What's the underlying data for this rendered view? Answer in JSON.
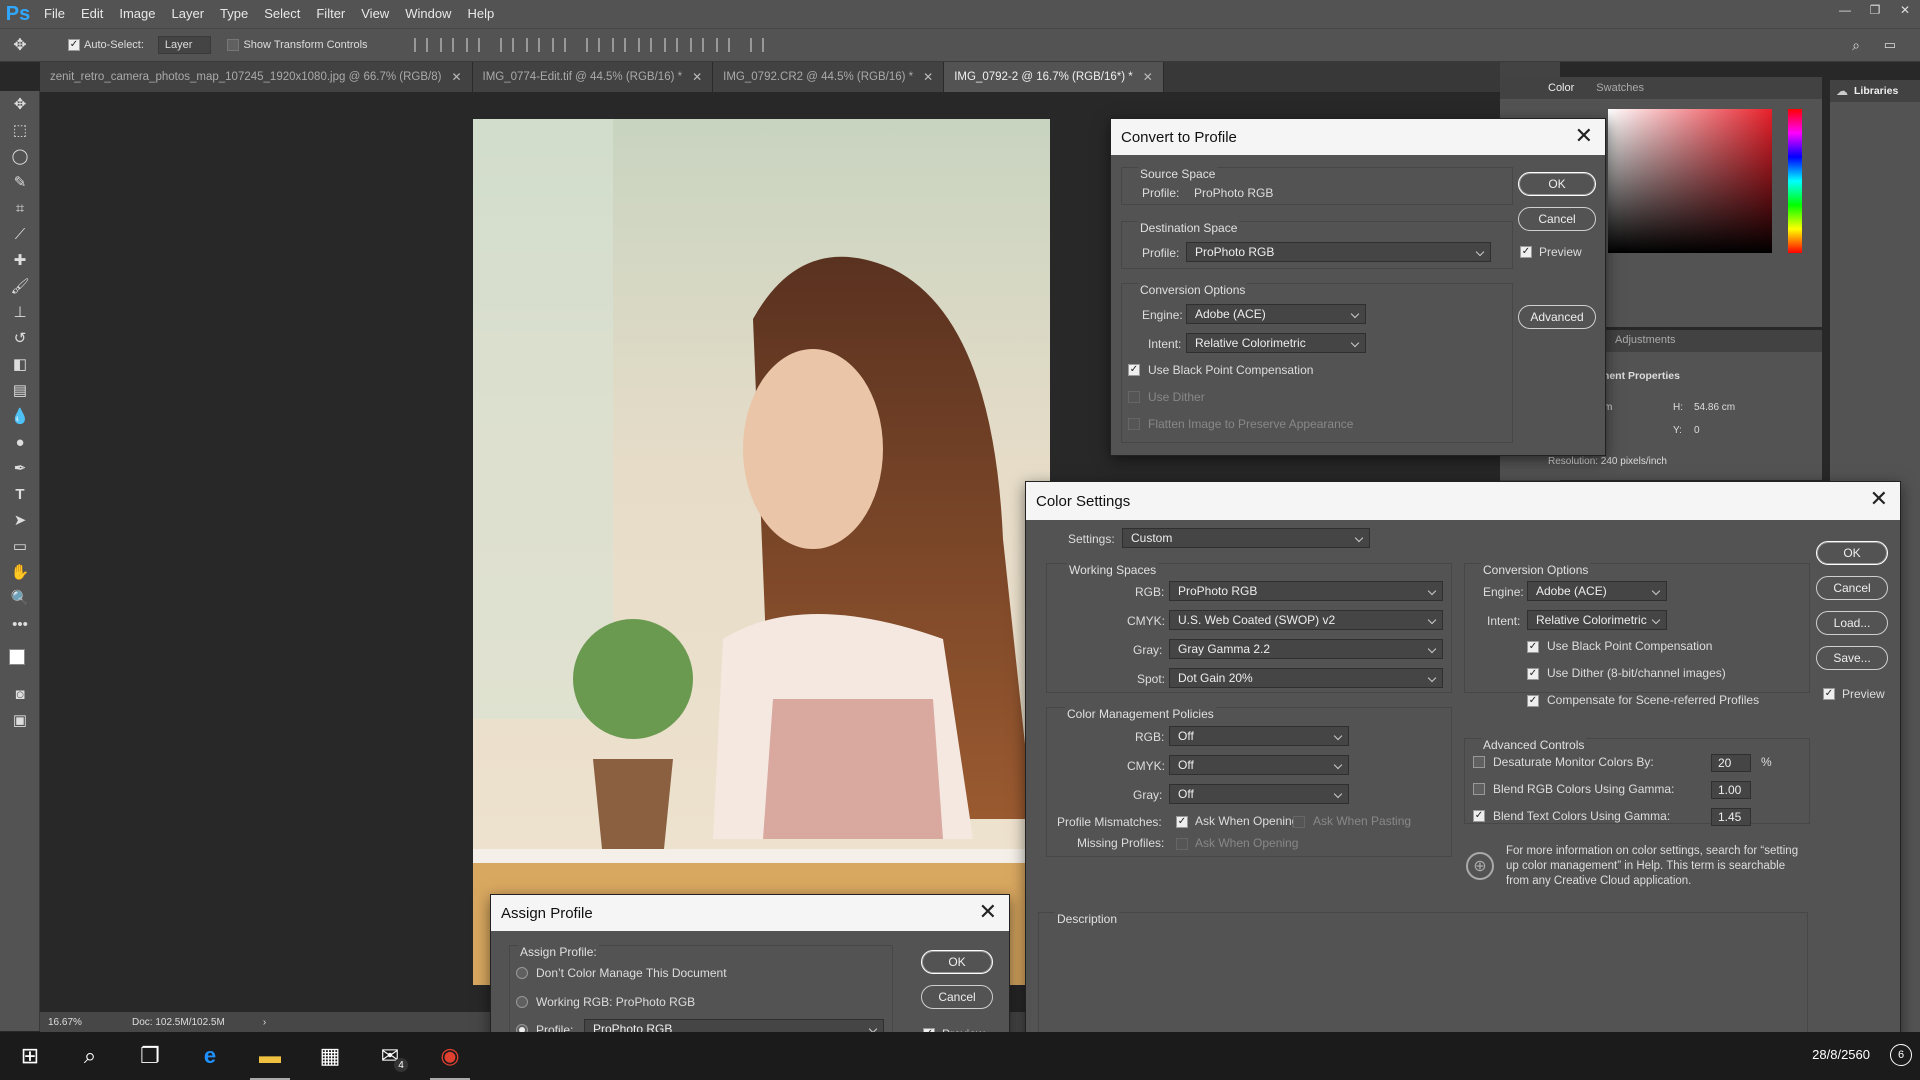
{
  "app": {
    "logo": "Ps",
    "menus": [
      "File",
      "Edit",
      "Image",
      "Layer",
      "Type",
      "Select",
      "Filter",
      "View",
      "Window",
      "Help"
    ]
  },
  "options_bar": {
    "auto_select_label": "Auto-Select:",
    "auto_select_value": "Layer",
    "show_transform_label": "Show Transform Controls"
  },
  "tabs": [
    {
      "label": "zenit_retro_camera_photos_map_107245_1920x1080.jpg @ 66.7% (RGB/8)",
      "active": false
    },
    {
      "label": "IMG_0774-Edit.tif @ 44.5% (RGB/16) *",
      "active": false
    },
    {
      "label": "IMG_0792.CR2 @ 44.5% (RGB/16) *",
      "active": false
    },
    {
      "label": "IMG_0792-2 @ 16.7% (RGB/16*) *",
      "active": true
    }
  ],
  "status": {
    "zoom": "16.67%",
    "doc": "Doc: 102.5M/102.5M"
  },
  "right_panels": {
    "color_tab": "Color",
    "swatches_tab": "Swatches",
    "adjustments_tab": "Adjustments",
    "properties_title": "ment Properties",
    "h_label": "H:",
    "h_value": "54.86 cm",
    "y_label": "Y:",
    "y_value": "0",
    "w_frag": "m",
    "resolution": "Resolution: 240 pixels/inch",
    "libraries": "Libraries"
  },
  "convert_profile": {
    "title": "Convert to Profile",
    "source_space": "Source Space",
    "source_profile_label": "Profile:",
    "source_profile": "ProPhoto RGB",
    "dest_space": "Destination Space",
    "dest_profile_label": "Profile:",
    "dest_profile": "ProPhoto RGB",
    "conv_options": "Conversion Options",
    "engine_label": "Engine:",
    "engine": "Adobe (ACE)",
    "intent_label": "Intent:",
    "intent": "Relative Colorimetric",
    "bpc": "Use Black Point Compensation",
    "dither": "Use Dither",
    "flatten": "Flatten Image to Preserve Appearance",
    "ok": "OK",
    "cancel": "Cancel",
    "preview": "Preview",
    "advanced": "Advanced"
  },
  "color_settings": {
    "title": "Color Settings",
    "settings_label": "Settings:",
    "settings": "Custom",
    "working_spaces": "Working Spaces",
    "rgb_label": "RGB:",
    "rgb": "ProPhoto RGB",
    "cmyk_label": "CMYK:",
    "cmyk": "U.S. Web Coated (SWOP) v2",
    "gray_label": "Gray:",
    "gray": "Gray Gamma 2.2",
    "spot_label": "Spot:",
    "spot": "Dot Gain 20%",
    "cmp_title": "Color Management Policies",
    "p_rgb_label": "RGB:",
    "p_rgb": "Off",
    "p_cmyk_label": "CMYK:",
    "p_cmyk": "Off",
    "p_gray_label": "Gray:",
    "p_gray": "Off",
    "mismatch_label": "Profile Mismatches:",
    "ask_opening": "Ask When Opening",
    "ask_pasting": "Ask When Pasting",
    "missing_label": "Missing Profiles:",
    "missing_ask": "Ask When Opening",
    "conv_title": "Conversion Options",
    "engine_label": "Engine:",
    "engine": "Adobe (ACE)",
    "intent_label": "Intent:",
    "intent": "Relative Colorimetric",
    "bpc": "Use Black Point Compensation",
    "dither": "Use Dither (8-bit/channel images)",
    "scene": "Compensate for Scene-referred Profiles",
    "adv_title": "Advanced Controls",
    "desat": "Desaturate Monitor Colors By:",
    "desat_val": "20",
    "pct": "%",
    "blend_rgb": "Blend RGB Colors Using Gamma:",
    "blend_rgb_val": "1.00",
    "blend_text": "Blend Text Colors Using Gamma:",
    "blend_text_val": "1.45",
    "info": "For more information on color settings, search for “setting up color management” in Help. This term is searchable from any Creative Cloud application.",
    "description": "Description",
    "ok": "OK",
    "cancel": "Cancel",
    "load": "Load...",
    "save": "Save...",
    "preview": "Preview"
  },
  "assign_profile": {
    "title": "Assign Profile",
    "group": "Assign Profile:",
    "dont": "Don’t Color Manage This Document",
    "working": "Working RGB:  ProPhoto RGB",
    "profile_label": "Profile:",
    "profile": "ProPhoto RGB",
    "ok": "OK",
    "cancel": "Cancel",
    "preview": "Preview"
  },
  "taskbar": {
    "mail_badge": "4",
    "date": "28/8/2560",
    "notif": "6"
  }
}
